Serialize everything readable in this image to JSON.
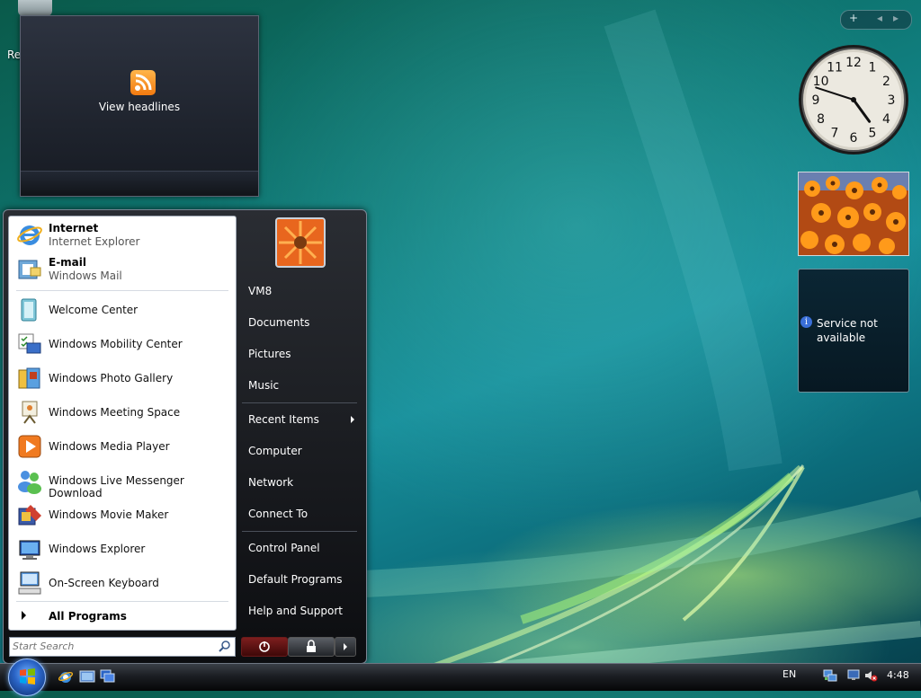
{
  "desktop": {
    "recycle_label": "Re"
  },
  "feed_gadget": {
    "label": "View headlines",
    "icon": "rss-icon"
  },
  "sidebar": {
    "controls": {
      "add": "+",
      "prev": "◂",
      "next": "▸"
    },
    "clock": {
      "numbers": [
        "12",
        "1",
        "2",
        "3",
        "4",
        "5",
        "6",
        "7",
        "8",
        "9",
        "10",
        "11"
      ],
      "hour": 4,
      "minute": 48
    },
    "weather": {
      "message": "Service not available",
      "icon": "info-icon"
    }
  },
  "start_menu": {
    "pinned": [
      {
        "title": "Internet",
        "subtitle": "Internet Explorer",
        "icon": "internet-explorer-icon"
      },
      {
        "title": "E-mail",
        "subtitle": "Windows Mail",
        "icon": "windows-mail-icon"
      }
    ],
    "recent": [
      {
        "label": "Welcome Center",
        "icon": "welcome-center-icon"
      },
      {
        "label": "Windows Mobility Center",
        "icon": "mobility-center-icon"
      },
      {
        "label": "Windows Photo Gallery",
        "icon": "photo-gallery-icon"
      },
      {
        "label": "Windows Meeting Space",
        "icon": "meeting-space-icon"
      },
      {
        "label": "Windows Media Player",
        "icon": "media-player-icon"
      },
      {
        "label": "Windows Live Messenger Download",
        "icon": "messenger-icon"
      },
      {
        "label": "Windows Movie Maker",
        "icon": "movie-maker-icon"
      },
      {
        "label": "Windows Explorer",
        "icon": "windows-explorer-icon"
      },
      {
        "label": "On-Screen Keyboard",
        "icon": "keyboard-icon"
      }
    ],
    "all_programs": "All Programs",
    "search_placeholder": "Start Search",
    "right_items": {
      "user": "VM8",
      "documents": "Documents",
      "pictures": "Pictures",
      "music": "Music",
      "recent_items": "Recent Items",
      "computer": "Computer",
      "network": "Network",
      "connect_to": "Connect To",
      "control_panel": "Control Panel",
      "default_programs": "Default Programs",
      "help": "Help and Support"
    }
  },
  "taskbar": {
    "language": "EN",
    "time": "4:48",
    "quick_launch": [
      "internet-explorer-icon",
      "show-desktop-icon",
      "switch-windows-icon"
    ],
    "tray": [
      "network-icon",
      "display-icon",
      "volume-muted-icon"
    ]
  }
}
